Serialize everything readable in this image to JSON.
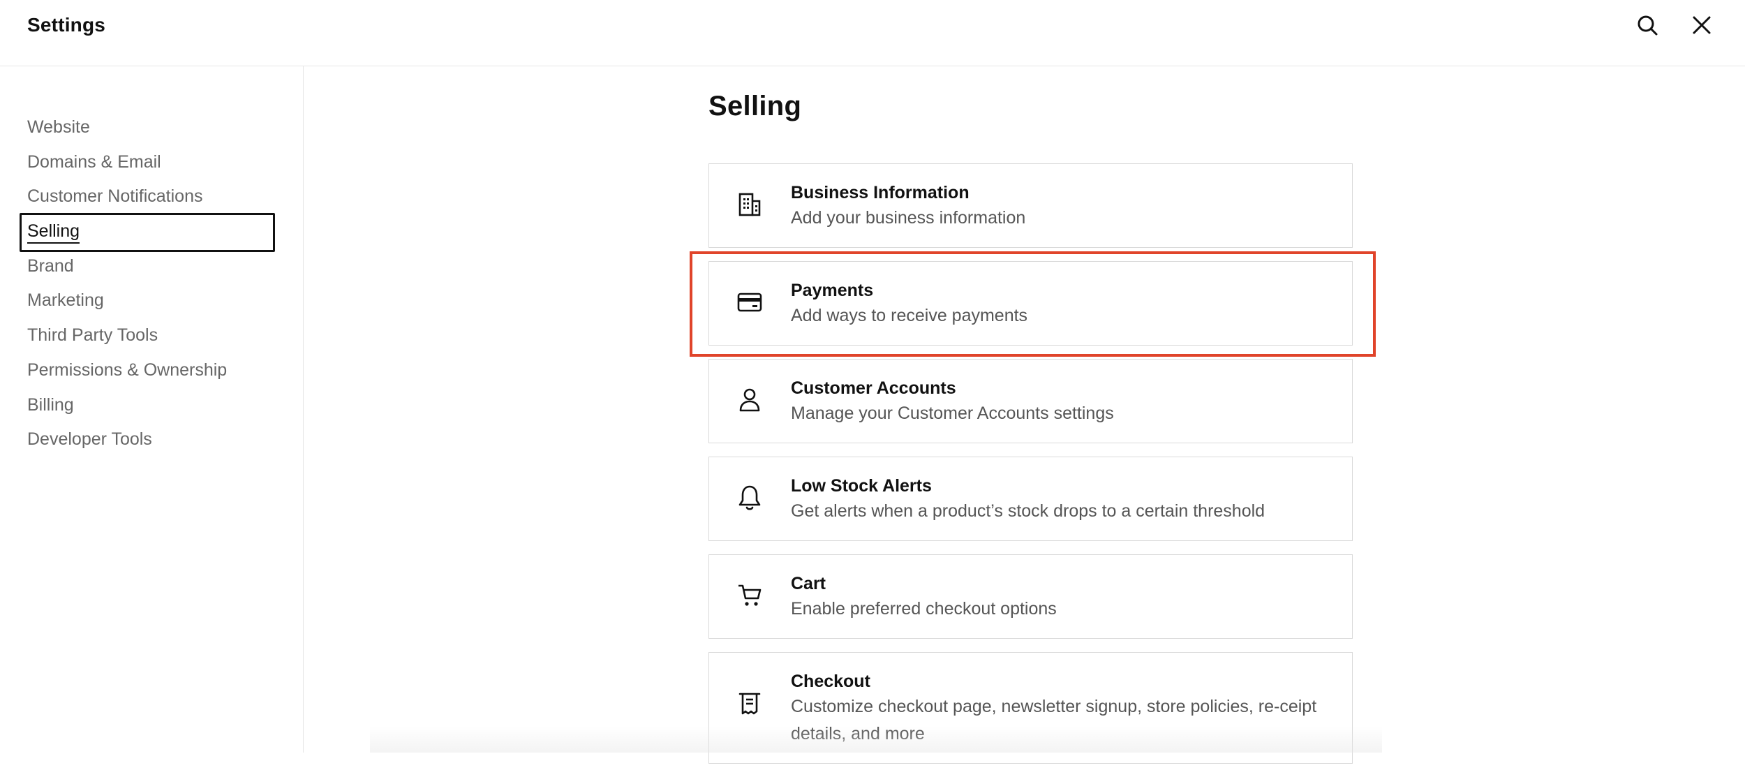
{
  "header": {
    "title": "Settings",
    "search_icon": "search-icon",
    "close_icon": "close-icon"
  },
  "sidebar": {
    "items": [
      {
        "label": "Website"
      },
      {
        "label": "Domains & Email"
      },
      {
        "label": "Customer Notifications"
      },
      {
        "label": "Selling",
        "active": true
      },
      {
        "label": "Brand"
      },
      {
        "label": "Marketing"
      },
      {
        "label": "Third Party Tools"
      },
      {
        "label": "Permissions & Ownership"
      },
      {
        "label": "Billing"
      },
      {
        "label": "Developer Tools"
      }
    ]
  },
  "main": {
    "title": "Selling",
    "cards": [
      {
        "icon": "building-icon",
        "title": "Business Information",
        "description": "Add your business information"
      },
      {
        "icon": "credit-card-icon",
        "title": "Payments",
        "description": "Add ways to receive payments",
        "highlighted": true
      },
      {
        "icon": "person-icon",
        "title": "Customer Accounts",
        "description": "Manage your Customer Accounts settings"
      },
      {
        "icon": "bell-icon",
        "title": "Low Stock Alerts",
        "description": "Get alerts when a product’s stock drops to a certain threshold"
      },
      {
        "icon": "cart-icon",
        "title": "Cart",
        "description": "Enable preferred checkout options"
      },
      {
        "icon": "receipt-icon",
        "title": "Checkout",
        "description": "Customize checkout page, newsletter signup, store policies, re-ceipt details, and more"
      }
    ]
  },
  "colors": {
    "highlight": "#e0442a",
    "text_primary": "#111111",
    "text_secondary": "#555555",
    "border": "#d9d9d9"
  }
}
